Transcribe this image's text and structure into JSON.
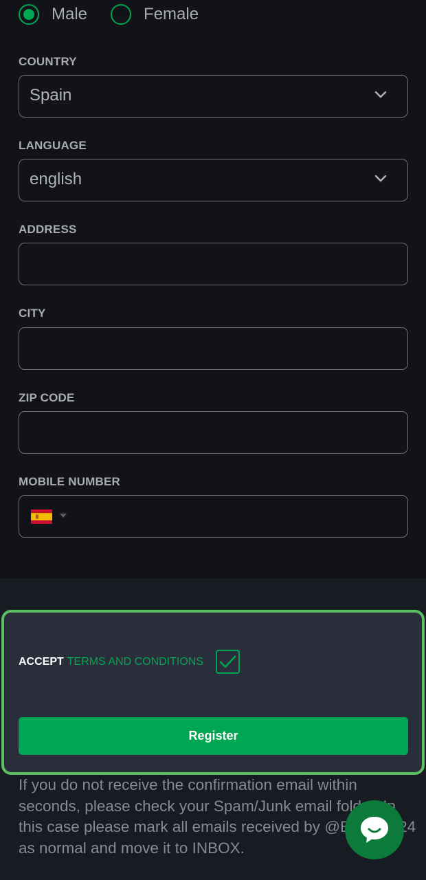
{
  "gender": {
    "options": [
      {
        "label": "Male",
        "selected": true
      },
      {
        "label": "Female",
        "selected": false
      }
    ]
  },
  "fields": {
    "country": {
      "label": "COUNTRY",
      "value": "Spain"
    },
    "language": {
      "label": "LANGUAGE",
      "value": "english"
    },
    "address": {
      "label": "ADDRESS",
      "value": ""
    },
    "city": {
      "label": "CITY",
      "value": ""
    },
    "zip": {
      "label": "ZIP CODE",
      "value": ""
    },
    "mobile": {
      "label": "MOBILE NUMBER",
      "value": "",
      "flag": "spain-flag-icon"
    }
  },
  "accept": {
    "prefix": "ACCEPT",
    "link": "TERMS AND CONDITIONS",
    "checked": true
  },
  "register": {
    "label": "Register"
  },
  "info": {
    "text": "If you do not receive the confirmation email within seconds, please check your Spam/Junk email folder. In this case please mark all emails received by @Betroom24 as normal and move it to INBOX."
  },
  "colors": {
    "accent": "#00a651",
    "background": "#121318",
    "panel": "#2a2e3a",
    "panel_border": "#5cbf61"
  },
  "icons": {
    "select_arrow": "chevron-down-icon",
    "check": "checkmark-icon",
    "chat": "chat-bubble-icon"
  }
}
